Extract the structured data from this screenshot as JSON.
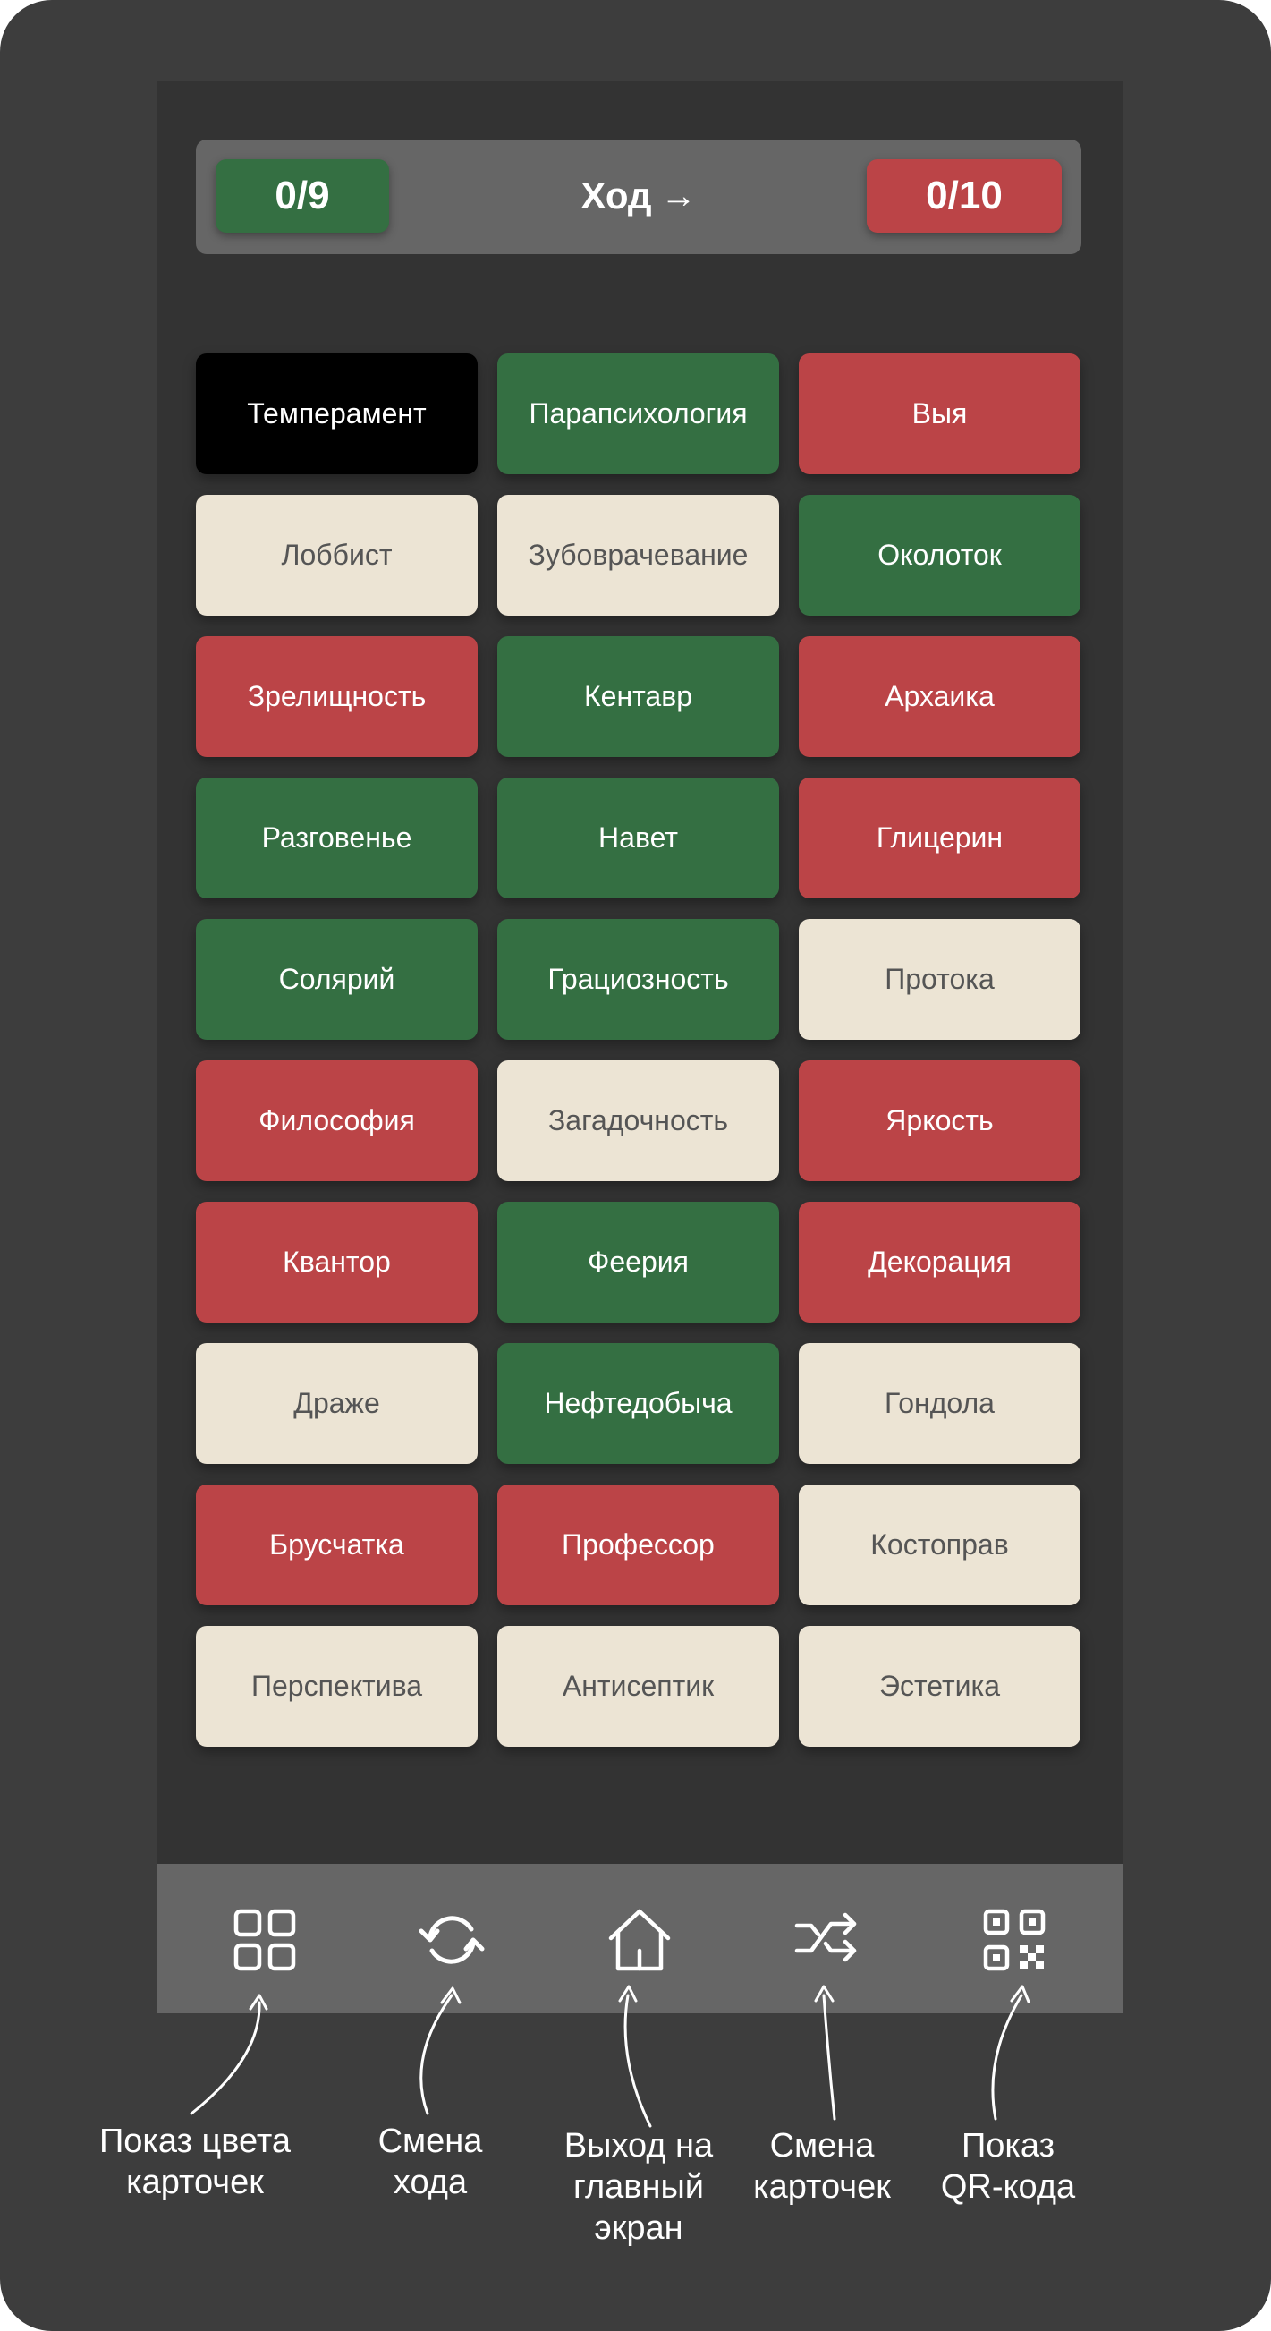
{
  "score": {
    "green": "0/9",
    "red": "0/10"
  },
  "turn": {
    "label": "Ход",
    "arrow": "→"
  },
  "colors": {
    "green": "#346f42",
    "red": "#bb4447",
    "neutral": "#ece4d4",
    "assassin": "#000000"
  },
  "cards": [
    {
      "word": "Темперамент",
      "color": "black"
    },
    {
      "word": "Парапсихология",
      "color": "green"
    },
    {
      "word": "Выя",
      "color": "red"
    },
    {
      "word": "Лоббист",
      "color": "beige"
    },
    {
      "word": "Зубоврачевание",
      "color": "beige"
    },
    {
      "word": "Околоток",
      "color": "green"
    },
    {
      "word": "Зрелищность",
      "color": "red"
    },
    {
      "word": "Кентавр",
      "color": "green"
    },
    {
      "word": "Архаика",
      "color": "red"
    },
    {
      "word": "Разговенье",
      "color": "green"
    },
    {
      "word": "Навет",
      "color": "green"
    },
    {
      "word": "Глицерин",
      "color": "red"
    },
    {
      "word": "Солярий",
      "color": "green"
    },
    {
      "word": "Грациозность",
      "color": "green"
    },
    {
      "word": "Протока",
      "color": "beige"
    },
    {
      "word": "Философия",
      "color": "red"
    },
    {
      "word": "Загадочность",
      "color": "beige"
    },
    {
      "word": "Яркость",
      "color": "red"
    },
    {
      "word": "Квантор",
      "color": "red"
    },
    {
      "word": "Феерия",
      "color": "green"
    },
    {
      "word": "Декорация",
      "color": "red"
    },
    {
      "word": "Драже",
      "color": "beige"
    },
    {
      "word": "Нефтедобыча",
      "color": "green"
    },
    {
      "word": "Гондола",
      "color": "beige"
    },
    {
      "word": "Брусчатка",
      "color": "red"
    },
    {
      "word": "Профессор",
      "color": "red"
    },
    {
      "word": "Костоправ",
      "color": "beige"
    },
    {
      "word": "Перспектива",
      "color": "beige"
    },
    {
      "word": "Антисептик",
      "color": "beige"
    },
    {
      "word": "Эстетика",
      "color": "beige"
    }
  ],
  "nav": [
    {
      "icon": "grid-icon",
      "caption": "Показ цвета\nкарточек"
    },
    {
      "icon": "refresh-icon",
      "caption": "Смена\nхода"
    },
    {
      "icon": "home-icon",
      "caption": "Выход на\nглавный\nэкран"
    },
    {
      "icon": "shuffle-icon",
      "caption": "Смена\nкарточек"
    },
    {
      "icon": "qr-code-icon",
      "caption": "Показ\nQR-кода"
    }
  ]
}
